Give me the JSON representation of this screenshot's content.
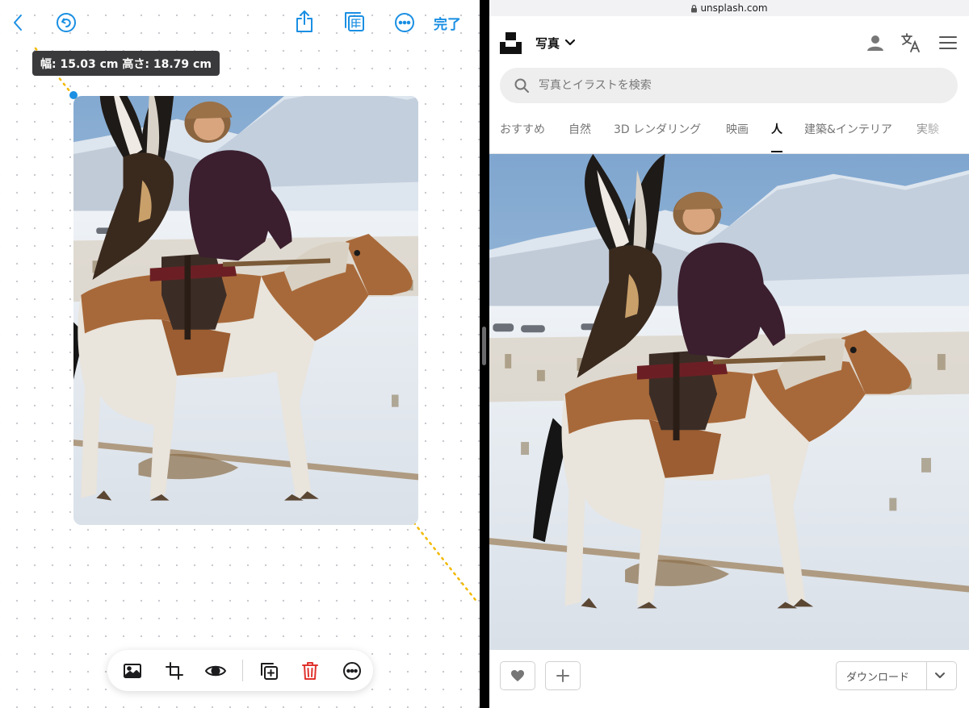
{
  "canvas": {
    "done_label": "完了",
    "size_tooltip": "幅: 15.03 cm  高さ: 18.79 cm"
  },
  "browser": {
    "domain": "unsplash.com",
    "media_menu_label": "写真",
    "search_placeholder": "写真とイラストを検索",
    "tabs": [
      {
        "label": "おすすめ",
        "active": false
      },
      {
        "label": "自然",
        "active": false
      },
      {
        "label": "3D レンダリング",
        "active": false
      },
      {
        "label": "映画",
        "active": false
      },
      {
        "label": "人",
        "active": true
      },
      {
        "label": "建築&インテリア",
        "active": false
      },
      {
        "label": "実験",
        "active": false
      }
    ],
    "download_label": "ダウンロード"
  },
  "colors": {
    "accent": "#1a8fe3",
    "delete": "#e0322c",
    "guide": "#f2b900"
  },
  "icons": {
    "canvas_toolbar": [
      "chevron-left-icon",
      "undo-icon",
      "share-icon",
      "copies-icon",
      "more-icon"
    ],
    "edit_toolbar": [
      "image-icon",
      "crop-icon",
      "eye-icon",
      "duplicate-icon",
      "trash-icon",
      "more-icon"
    ],
    "browser_header": [
      "lock-icon",
      "unsplash-logo",
      "chevron-down-icon",
      "user-icon",
      "translate-icon",
      "menu-icon"
    ],
    "photo_actions": [
      "heart-icon",
      "plus-icon",
      "chevron-down-icon"
    ]
  }
}
